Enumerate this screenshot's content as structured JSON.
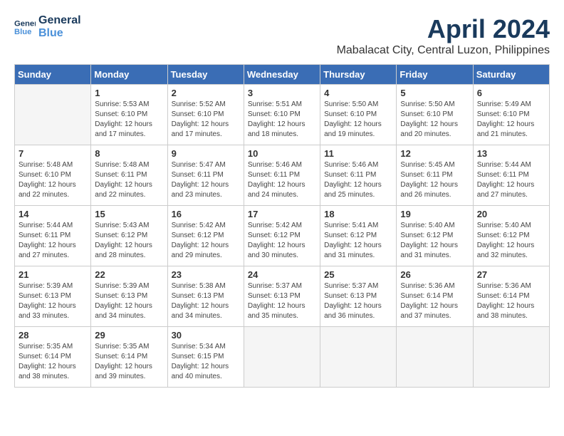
{
  "header": {
    "logo_line1": "General",
    "logo_line2": "Blue",
    "month": "April 2024",
    "location": "Mabalacat City, Central Luzon, Philippines"
  },
  "weekdays": [
    "Sunday",
    "Monday",
    "Tuesday",
    "Wednesday",
    "Thursday",
    "Friday",
    "Saturday"
  ],
  "weeks": [
    [
      {
        "day": "",
        "info": ""
      },
      {
        "day": "1",
        "info": "Sunrise: 5:53 AM\nSunset: 6:10 PM\nDaylight: 12 hours\nand 17 minutes."
      },
      {
        "day": "2",
        "info": "Sunrise: 5:52 AM\nSunset: 6:10 PM\nDaylight: 12 hours\nand 17 minutes."
      },
      {
        "day": "3",
        "info": "Sunrise: 5:51 AM\nSunset: 6:10 PM\nDaylight: 12 hours\nand 18 minutes."
      },
      {
        "day": "4",
        "info": "Sunrise: 5:50 AM\nSunset: 6:10 PM\nDaylight: 12 hours\nand 19 minutes."
      },
      {
        "day": "5",
        "info": "Sunrise: 5:50 AM\nSunset: 6:10 PM\nDaylight: 12 hours\nand 20 minutes."
      },
      {
        "day": "6",
        "info": "Sunrise: 5:49 AM\nSunset: 6:10 PM\nDaylight: 12 hours\nand 21 minutes."
      }
    ],
    [
      {
        "day": "7",
        "info": "Sunrise: 5:48 AM\nSunset: 6:10 PM\nDaylight: 12 hours\nand 22 minutes."
      },
      {
        "day": "8",
        "info": "Sunrise: 5:48 AM\nSunset: 6:11 PM\nDaylight: 12 hours\nand 22 minutes."
      },
      {
        "day": "9",
        "info": "Sunrise: 5:47 AM\nSunset: 6:11 PM\nDaylight: 12 hours\nand 23 minutes."
      },
      {
        "day": "10",
        "info": "Sunrise: 5:46 AM\nSunset: 6:11 PM\nDaylight: 12 hours\nand 24 minutes."
      },
      {
        "day": "11",
        "info": "Sunrise: 5:46 AM\nSunset: 6:11 PM\nDaylight: 12 hours\nand 25 minutes."
      },
      {
        "day": "12",
        "info": "Sunrise: 5:45 AM\nSunset: 6:11 PM\nDaylight: 12 hours\nand 26 minutes."
      },
      {
        "day": "13",
        "info": "Sunrise: 5:44 AM\nSunset: 6:11 PM\nDaylight: 12 hours\nand 27 minutes."
      }
    ],
    [
      {
        "day": "14",
        "info": "Sunrise: 5:44 AM\nSunset: 6:11 PM\nDaylight: 12 hours\nand 27 minutes."
      },
      {
        "day": "15",
        "info": "Sunrise: 5:43 AM\nSunset: 6:12 PM\nDaylight: 12 hours\nand 28 minutes."
      },
      {
        "day": "16",
        "info": "Sunrise: 5:42 AM\nSunset: 6:12 PM\nDaylight: 12 hours\nand 29 minutes."
      },
      {
        "day": "17",
        "info": "Sunrise: 5:42 AM\nSunset: 6:12 PM\nDaylight: 12 hours\nand 30 minutes."
      },
      {
        "day": "18",
        "info": "Sunrise: 5:41 AM\nSunset: 6:12 PM\nDaylight: 12 hours\nand 31 minutes."
      },
      {
        "day": "19",
        "info": "Sunrise: 5:40 AM\nSunset: 6:12 PM\nDaylight: 12 hours\nand 31 minutes."
      },
      {
        "day": "20",
        "info": "Sunrise: 5:40 AM\nSunset: 6:12 PM\nDaylight: 12 hours\nand 32 minutes."
      }
    ],
    [
      {
        "day": "21",
        "info": "Sunrise: 5:39 AM\nSunset: 6:13 PM\nDaylight: 12 hours\nand 33 minutes."
      },
      {
        "day": "22",
        "info": "Sunrise: 5:39 AM\nSunset: 6:13 PM\nDaylight: 12 hours\nand 34 minutes."
      },
      {
        "day": "23",
        "info": "Sunrise: 5:38 AM\nSunset: 6:13 PM\nDaylight: 12 hours\nand 34 minutes."
      },
      {
        "day": "24",
        "info": "Sunrise: 5:37 AM\nSunset: 6:13 PM\nDaylight: 12 hours\nand 35 minutes."
      },
      {
        "day": "25",
        "info": "Sunrise: 5:37 AM\nSunset: 6:13 PM\nDaylight: 12 hours\nand 36 minutes."
      },
      {
        "day": "26",
        "info": "Sunrise: 5:36 AM\nSunset: 6:14 PM\nDaylight: 12 hours\nand 37 minutes."
      },
      {
        "day": "27",
        "info": "Sunrise: 5:36 AM\nSunset: 6:14 PM\nDaylight: 12 hours\nand 38 minutes."
      }
    ],
    [
      {
        "day": "28",
        "info": "Sunrise: 5:35 AM\nSunset: 6:14 PM\nDaylight: 12 hours\nand 38 minutes."
      },
      {
        "day": "29",
        "info": "Sunrise: 5:35 AM\nSunset: 6:14 PM\nDaylight: 12 hours\nand 39 minutes."
      },
      {
        "day": "30",
        "info": "Sunrise: 5:34 AM\nSunset: 6:15 PM\nDaylight: 12 hours\nand 40 minutes."
      },
      {
        "day": "",
        "info": ""
      },
      {
        "day": "",
        "info": ""
      },
      {
        "day": "",
        "info": ""
      },
      {
        "day": "",
        "info": ""
      }
    ]
  ]
}
